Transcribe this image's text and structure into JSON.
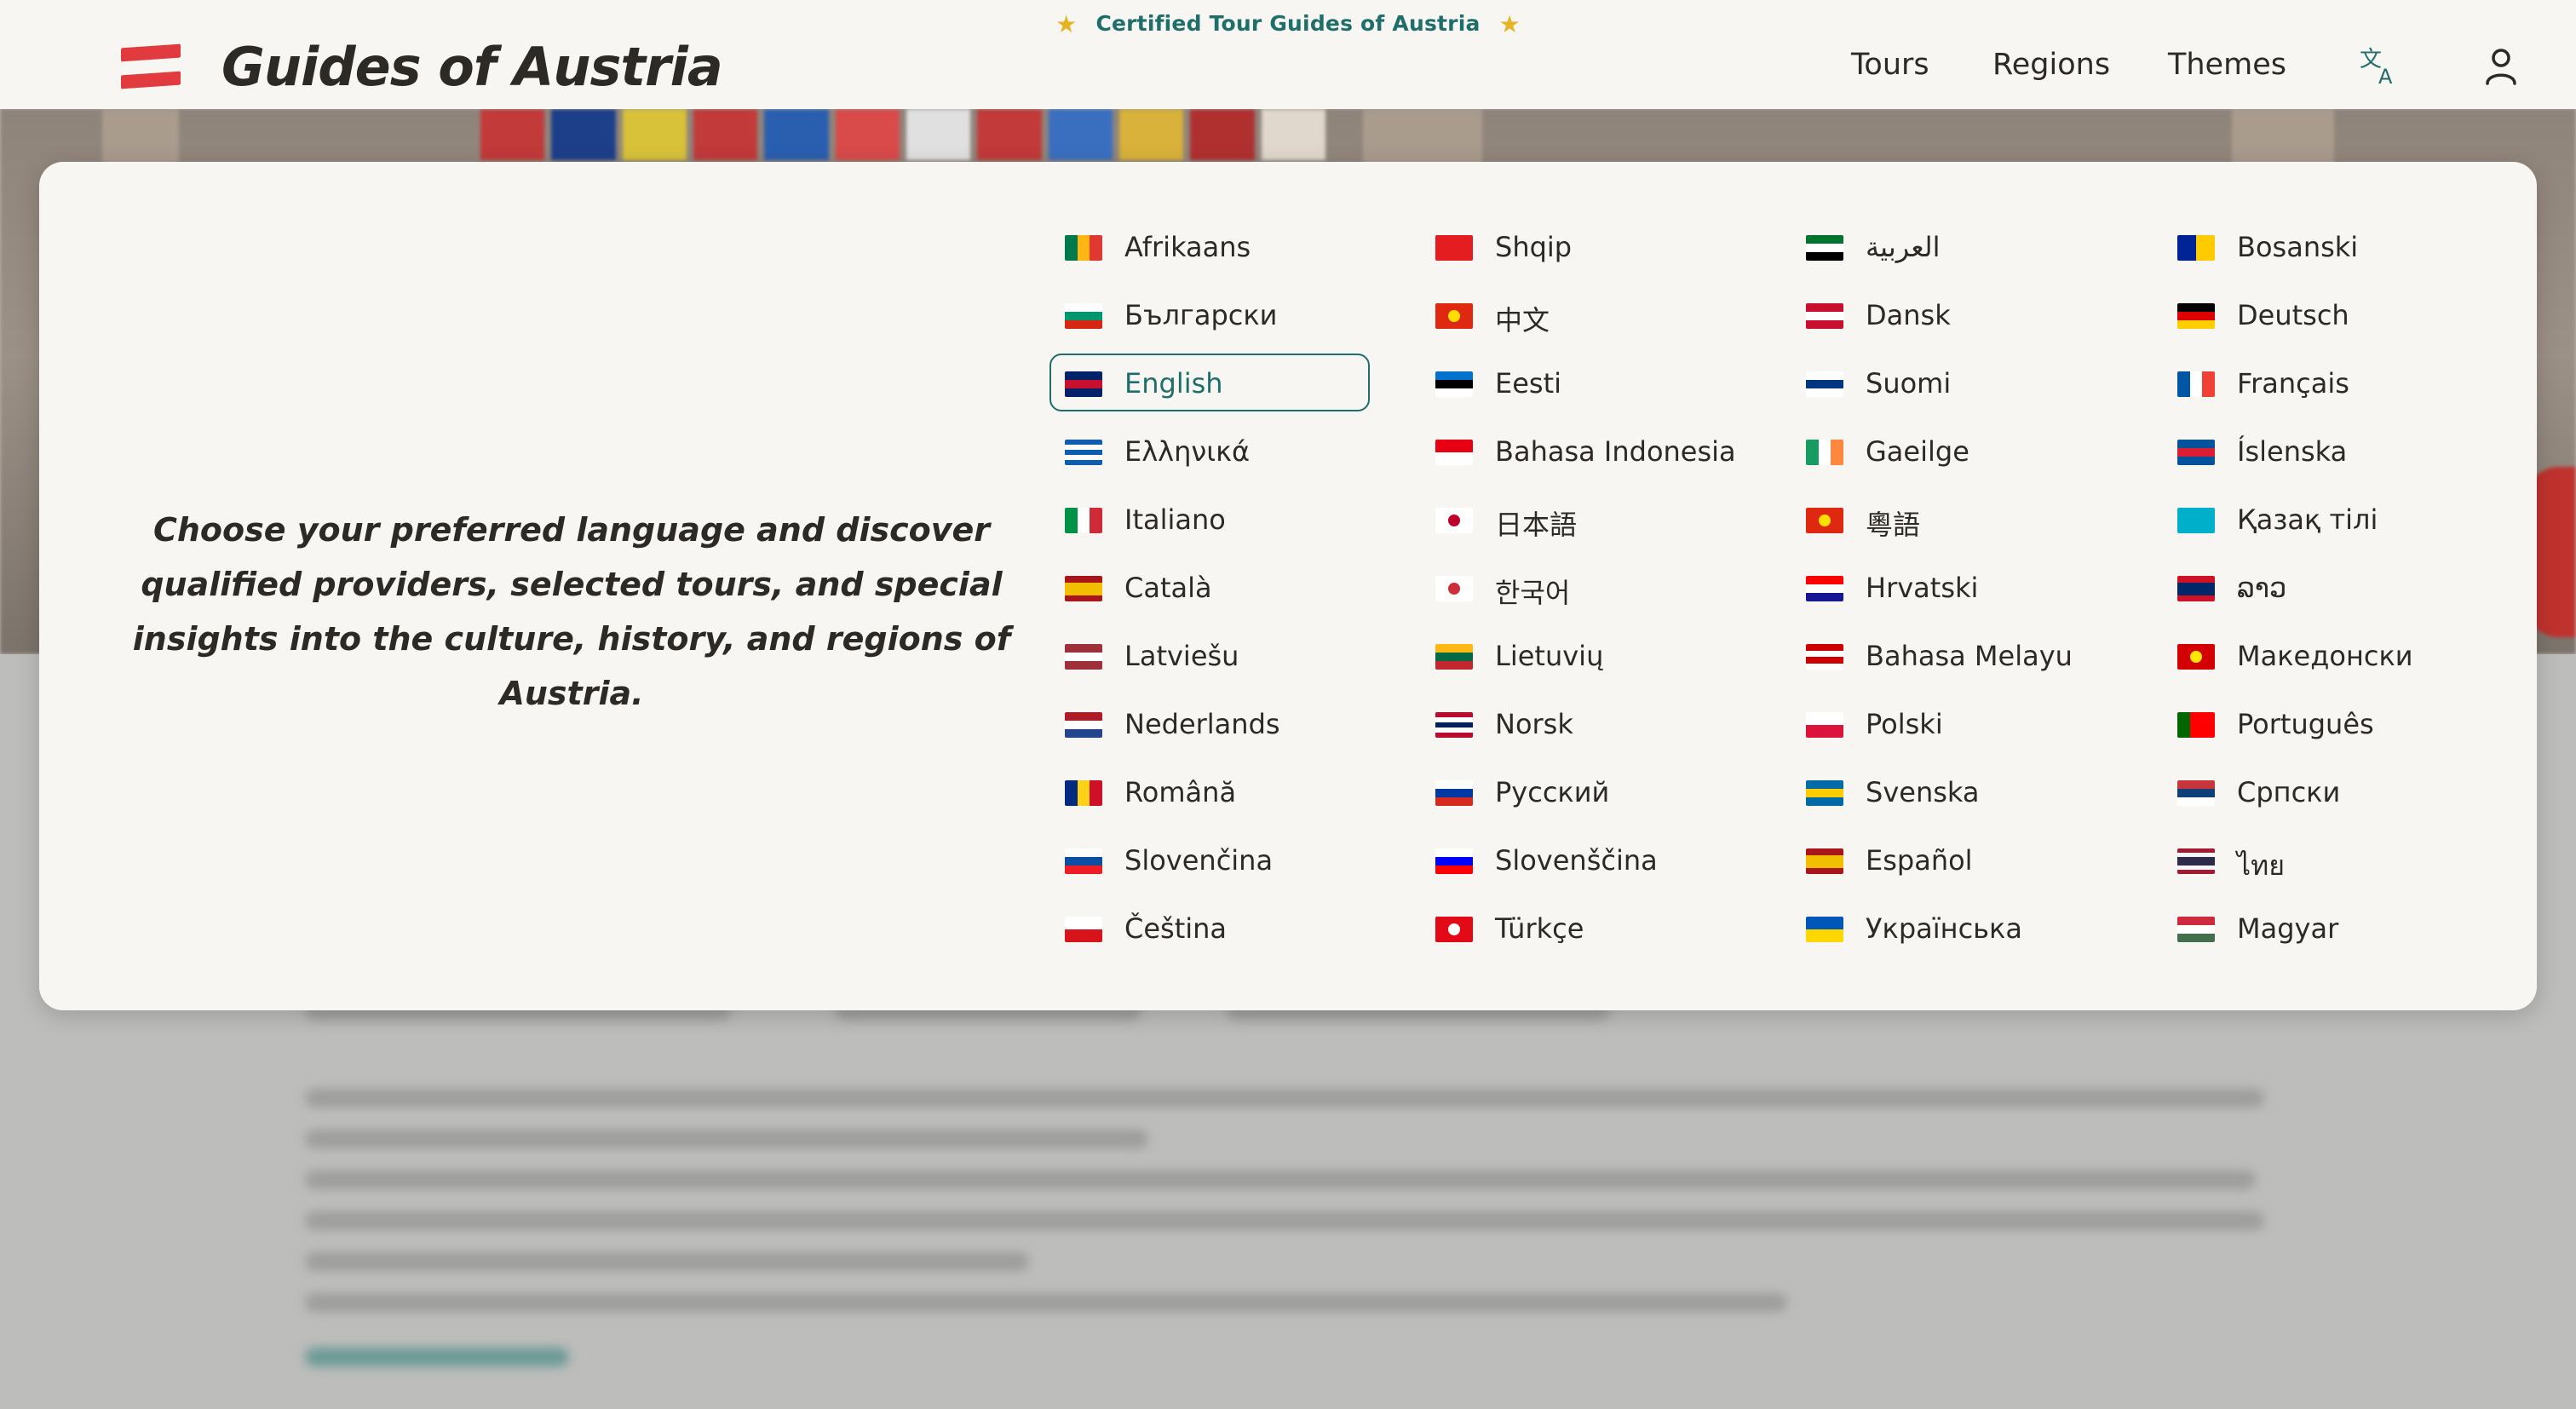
{
  "header": {
    "tagline": "Certified Tour Guides of Austria",
    "logo_text": "Guides of Austria",
    "nav": {
      "tours": "Tours",
      "regions": "Regions",
      "themes": "Themes"
    },
    "icons": [
      "austria-flag-icon",
      "translate-icon",
      "user-icon"
    ],
    "colors": {
      "accent": "#1f6e6a",
      "star": "#e6b325",
      "flag_red": "#e23b3f",
      "text": "#2d2a25"
    }
  },
  "language_menu": {
    "intro": "Choose your preferred language and discover qualified providers, selected tours, and special insights into the culture, history, and regions of Austria.",
    "selected": "English",
    "languages": [
      {
        "name": "Afrikaans"
      },
      {
        "name": "Shqip"
      },
      {
        "name": "العربية"
      },
      {
        "name": "Bosanski"
      },
      {
        "name": "Български"
      },
      {
        "name": "中文"
      },
      {
        "name": "Dansk"
      },
      {
        "name": "Deutsch"
      },
      {
        "name": "English"
      },
      {
        "name": "Eesti"
      },
      {
        "name": "Suomi"
      },
      {
        "name": "Français"
      },
      {
        "name": "Ελληνικά"
      },
      {
        "name": "Bahasa Indonesia"
      },
      {
        "name": "Gaeilge"
      },
      {
        "name": "Íslenska"
      },
      {
        "name": "Italiano"
      },
      {
        "name": "日本語"
      },
      {
        "name": "粵語"
      },
      {
        "name": "Қазақ тілі"
      },
      {
        "name": "Català"
      },
      {
        "name": "한국어"
      },
      {
        "name": "Hrvatski"
      },
      {
        "name": "ລາວ"
      },
      {
        "name": "Latviešu"
      },
      {
        "name": "Lietuvių"
      },
      {
        "name": "Bahasa Melayu"
      },
      {
        "name": "Македонски"
      },
      {
        "name": "Nederlands"
      },
      {
        "name": "Norsk"
      },
      {
        "name": "Polski"
      },
      {
        "name": "Português"
      },
      {
        "name": "Română"
      },
      {
        "name": "Русский"
      },
      {
        "name": "Svenska"
      },
      {
        "name": "Српски"
      },
      {
        "name": "Slovenčina"
      },
      {
        "name": "Slovenščina"
      },
      {
        "name": "Español"
      },
      {
        "name": "ไทย"
      },
      {
        "name": "Čeština"
      },
      {
        "name": "Türkçe"
      },
      {
        "name": "Українська"
      },
      {
        "name": "Magyar"
      }
    ]
  }
}
